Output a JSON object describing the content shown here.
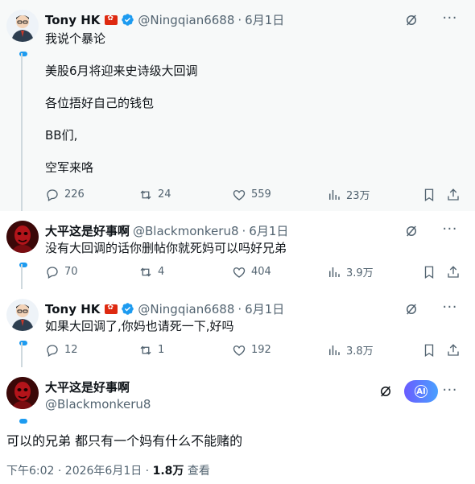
{
  "colors": {
    "accent": "#1d9bf0",
    "text": "#0f1419",
    "muted": "#536471"
  },
  "thread": [
    {
      "author": {
        "name": "Tony HK",
        "handle": "@Ningqian6688",
        "verified": true,
        "flag": "hong-kong-flag"
      },
      "date": "6月1日",
      "lines": [
        "我说个暴论",
        "美股6月将迎来史诗级大回调",
        "各位捂好自己的钱包",
        "BB们,",
        "空军来咯"
      ],
      "stats": {
        "replies": "226",
        "reposts": "24",
        "likes": "559",
        "views": "23万"
      }
    },
    {
      "author": {
        "name": "大平这是好事啊",
        "handle": "@Blackmonkeru8",
        "verified": false
      },
      "date": "6月1日",
      "lines": [
        "没有大回调的话你删帖你就死妈可以吗好兄弟"
      ],
      "stats": {
        "replies": "70",
        "reposts": "4",
        "likes": "404",
        "views": "3.9万"
      }
    },
    {
      "author": {
        "name": "Tony HK",
        "handle": "@Ningqian6688",
        "verified": true,
        "flag": "hong-kong-flag"
      },
      "date": "6月1日",
      "lines": [
        "如果大回调了,你妈也请死一下,好吗"
      ],
      "stats": {
        "replies": "12",
        "reposts": "1",
        "likes": "192",
        "views": "3.8万"
      }
    }
  ],
  "focus": {
    "author": {
      "name": "大平这是好事啊",
      "handle": "@Blackmonkeru8"
    },
    "grok_label": "AI",
    "text": "可以的兄弟 都只有一个妈有什么不能赌的",
    "time": "下午6:02 · 2026年6月1日 · ",
    "views": "1.8万",
    "views_label": " 查看"
  },
  "dot": "·"
}
